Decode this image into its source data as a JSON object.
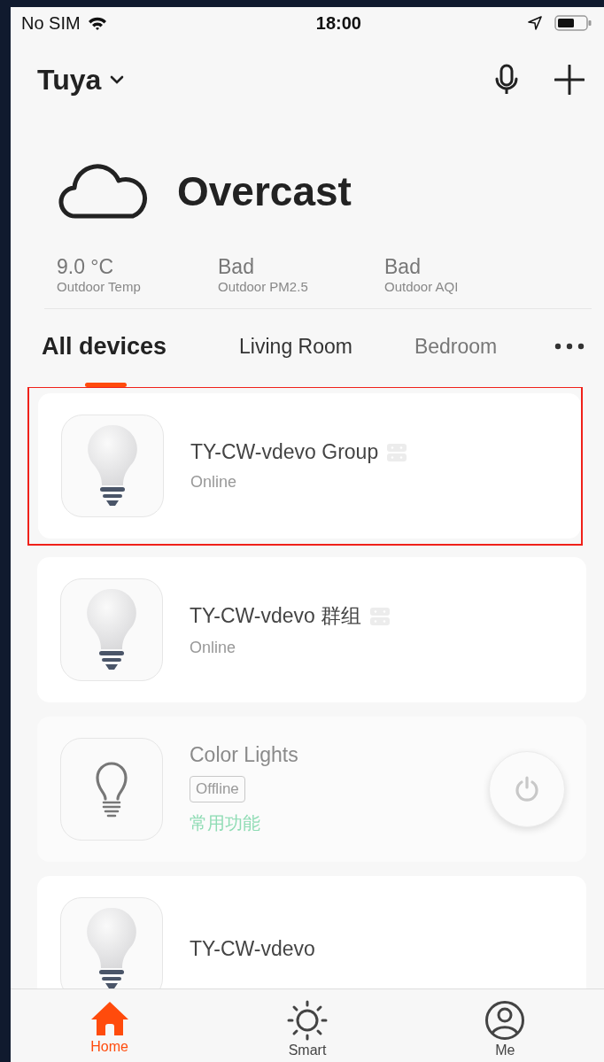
{
  "status_bar": {
    "carrier": "No SIM",
    "time": "18:00"
  },
  "header": {
    "home_name": "Tuya"
  },
  "weather": {
    "condition": "Overcast",
    "stats": [
      {
        "value": "9.0 °C",
        "label": "Outdoor Temp"
      },
      {
        "value": "Bad",
        "label": "Outdoor PM2.5"
      },
      {
        "value": "Bad",
        "label": "Outdoor AQI"
      }
    ]
  },
  "tabs": [
    {
      "label": "All devices",
      "selected": true
    },
    {
      "label": "Living Room",
      "selected": false
    },
    {
      "label": "Bedroom",
      "selected": false
    }
  ],
  "devices": [
    {
      "kind": "online",
      "name": "TY-CW-vdevo Group",
      "group": true,
      "status": "Online",
      "highlighted": true
    },
    {
      "kind": "online",
      "name": "TY-CW-vdevo 群组",
      "group": true,
      "status": "Online",
      "highlighted": false
    },
    {
      "kind": "offline",
      "name": "Color Lights",
      "group": false,
      "status": "Offline",
      "action": "常用功能",
      "highlighted": false
    },
    {
      "kind": "online",
      "name": "TY-CW-vdevo",
      "group": false,
      "highlighted": false
    }
  ],
  "bottom_nav": [
    {
      "label": "Home",
      "selected": true
    },
    {
      "label": "Smart",
      "selected": false
    },
    {
      "label": "Me",
      "selected": false
    }
  ]
}
